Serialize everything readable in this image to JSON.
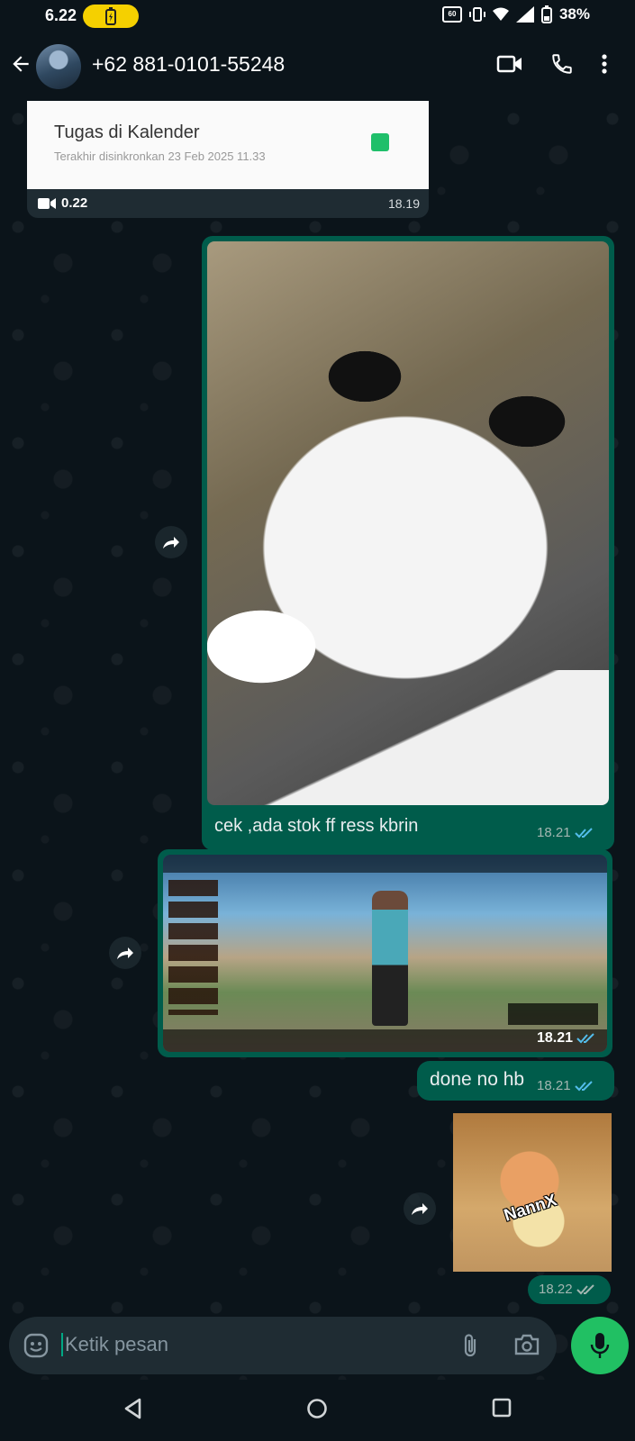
{
  "status_bar": {
    "time": "6.22",
    "network_badge": "60",
    "battery_pct": "38%"
  },
  "header": {
    "contact_name": "+62 881-0101-55248"
  },
  "messages": {
    "incoming_card": {
      "title": "Tugas di Kalender",
      "subtitle": "Terakhir disinkronkan 23 Feb 2025 11.33",
      "video_duration": "0.22",
      "time": "18.19"
    },
    "cat_image": {
      "caption": "cek ,ada stok ff ress kbrin",
      "time": "18.21"
    },
    "game_screenshot": {
      "time": "18.21"
    },
    "text_message": {
      "text": "done no hb",
      "time": "18.21"
    },
    "sticker": {
      "label": "NannX",
      "time": "18.22"
    }
  },
  "composer": {
    "placeholder": "Ketik pesan"
  },
  "colors": {
    "background": "#0b141a",
    "outgoing_bubble": "#005c4b",
    "incoming_bubble": "#1f2c33",
    "accent": "#21c063",
    "read_ticks": "#53bdeb"
  },
  "icons": [
    "back-arrow-icon",
    "video-call-icon",
    "phone-icon",
    "more-vert-icon",
    "forward-icon",
    "emoji-sticker-icon",
    "attach-icon",
    "camera-icon",
    "mic-icon",
    "nav-back-icon",
    "nav-home-icon",
    "nav-recents-icon"
  ]
}
